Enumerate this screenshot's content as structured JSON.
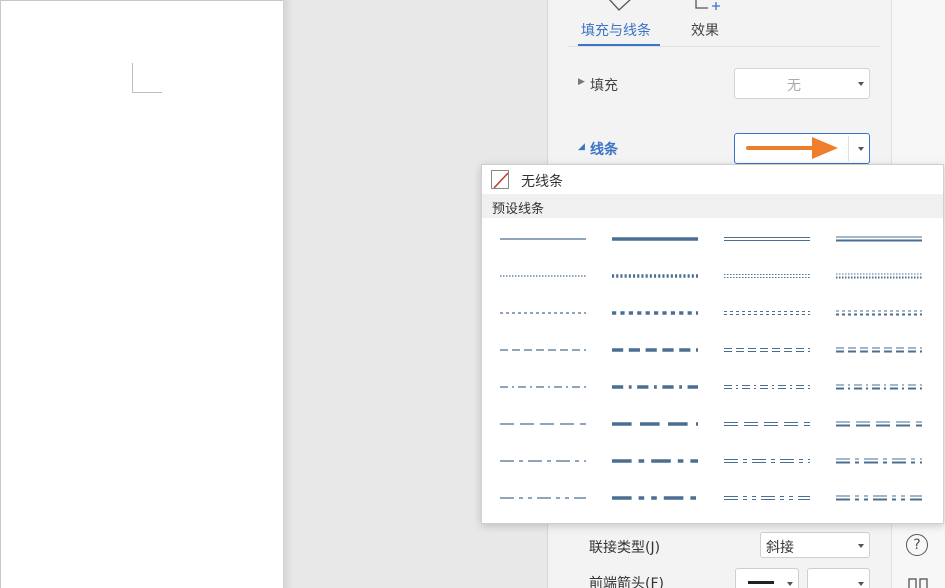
{
  "pane": {
    "tabs": [
      {
        "label": "填充与线条",
        "active": true,
        "icon": "shape-fill-icon"
      },
      {
        "label": "效果",
        "active": false,
        "icon": "shape-effect-icon"
      }
    ],
    "fill": {
      "label": "填充",
      "value": "无"
    },
    "line": {
      "label": "线条"
    },
    "join_type": {
      "label": "联接类型(J)",
      "value": "斜接"
    },
    "begin_arrow": {
      "label": "前端箭头(F)"
    }
  },
  "popup": {
    "none_label": "无线条",
    "preset_label": "预设线条",
    "styles": [
      "solid",
      "round-dot",
      "square-dot",
      "dash",
      "dash-dot",
      "long-dash",
      "long-dash-dot",
      "long-dash-dot-dot"
    ],
    "widths": [
      "thin",
      "thick",
      "double",
      "thin-thick"
    ]
  },
  "sidebar": {
    "help_icon": "help-icon",
    "more_icon": "grid-icon"
  },
  "colors": {
    "accent": "#3b73c6",
    "line_preview": "#4a6f92",
    "annotation_arrow": "#ee7d2c",
    "no_line_slash": "#c0392b"
  }
}
